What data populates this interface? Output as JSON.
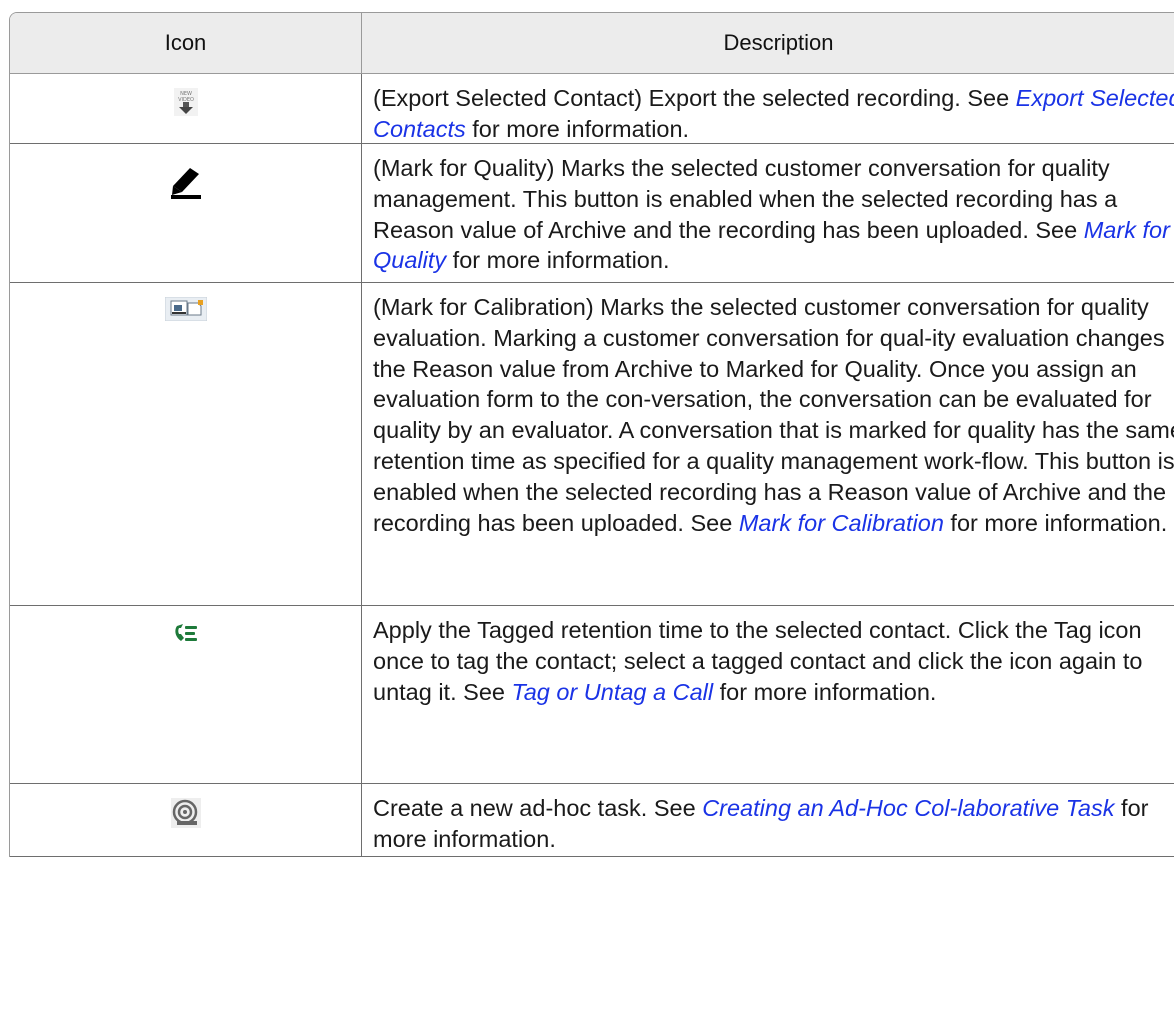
{
  "table": {
    "headers": {
      "icon": "Icon",
      "description": "Description"
    },
    "rows": [
      {
        "icon": "export-video-icon",
        "before": "(Export Selected Contact) Export the selected recording. See ",
        "link": "Export Selected Contacts",
        "after": " for more information."
      },
      {
        "icon": "pen-icon",
        "before": "(Mark for Quality) Marks the selected customer conversation for quality management. This button is enabled when the selected recording has a Reason value of Archive and the recording has been uploaded. See ",
        "link": "Mark for Quality",
        "after": "  for more information."
      },
      {
        "icon": "calibration-icon",
        "before": "(Mark for Calibration) Marks the selected customer conversation for quality evaluation. Marking a customer conversation for qual-ity evaluation changes the Reason value from Archive to Marked for Quality. Once you assign an evaluation form to the con-versation, the conversation can be evaluated for quality by an evaluator. A conversation that is marked for quality has the same retention time as specified for a quality management work-flow. This button is enabled when the selected recording has a Reason value of Archive and the recording has been uploaded. See ",
        "link": "Mark for Calibration",
        "after": " for more information."
      },
      {
        "icon": "tag-call-icon",
        "before": "Apply the Tagged retention time to the selected contact. Click the Tag icon once to tag the contact; select a tagged contact and click the icon again to untag it. See ",
        "link": "Tag or Untag a Call",
        "after": " for more information."
      },
      {
        "icon": "collaborative-task-icon",
        "before": "Create a new ad-hoc task. See ",
        "link": "Creating an Ad-Hoc Col-laborative Task",
        "after": " for more information."
      }
    ]
  }
}
